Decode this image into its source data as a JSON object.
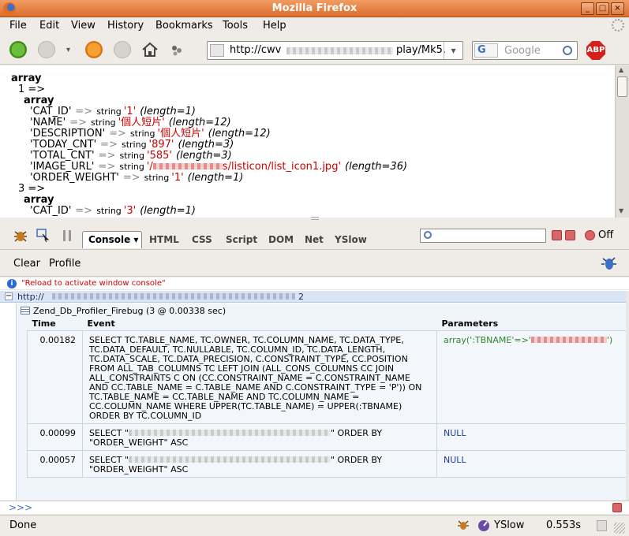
{
  "window": {
    "title": "Mozilla Firefox"
  },
  "menu": [
    "File",
    "Edit",
    "View",
    "History",
    "Bookmarks",
    "Tools",
    "Help"
  ],
  "nav": {
    "url_prefix": "http://cwv",
    "url_suffix": "play/Mk5.",
    "search_engine": "G",
    "search_placeholder": "Google",
    "adblock_label": "ABP"
  },
  "content": {
    "lines": [
      {
        "indent": 0,
        "key": "array",
        "bold": true
      },
      {
        "indent": 1,
        "key": "1 =>"
      },
      {
        "indent": 1,
        "key": "array",
        "bold": true
      },
      {
        "indent": 2,
        "key": "'CAT_ID'",
        "type": "string",
        "value": "'1'",
        "len": "(length=1)"
      },
      {
        "indent": 2,
        "key": "'NAME'",
        "type": "string",
        "value": "'個人短片'",
        "len": "(length=12)"
      },
      {
        "indent": 2,
        "key": "'DESCRIPTION'",
        "type": "string",
        "value": "'個人短片'",
        "len": "(length=12)"
      },
      {
        "indent": 2,
        "key": "'TODAY_CNT'",
        "type": "string",
        "value": "'897'",
        "len": "(length=3)"
      },
      {
        "indent": 2,
        "key": "'TOTAL_CNT'",
        "type": "string",
        "value": "'585'",
        "len": "(length=3)"
      },
      {
        "indent": 2,
        "key": "'IMAGE_URL'",
        "type": "string",
        "value": "'/",
        "value2": "s/listicon/list_icon1.jpg'",
        "len": "(length=36)"
      },
      {
        "indent": 2,
        "key": "'ORDER_WEIGHT'",
        "type": "string",
        "value": "'1'",
        "len": "(length=1)"
      },
      {
        "indent": 1,
        "key": "3 =>"
      },
      {
        "indent": 1,
        "key": "array",
        "bold": true
      },
      {
        "indent": 2,
        "key": "'CAT_ID'",
        "type": "string",
        "value": "'3'",
        "len": "(length=1)"
      }
    ],
    "arrow": "=>"
  },
  "firebug": {
    "tabs": [
      "HTML",
      "CSS",
      "Script",
      "DOM",
      "Net",
      "YSlow"
    ],
    "console_tab": "Console ▾",
    "off_label": "Off",
    "clear": "Clear",
    "profile": "Profile",
    "info_message": "\"Reload to activate window console\"",
    "group_prefix": "http://",
    "group_suffix": "2",
    "profiler_title": "Zend_Db_Profiler_Firebug (3 @ 0.00338 sec)",
    "columns": [
      "Time",
      "Event",
      "Parameters"
    ],
    "rows": [
      {
        "time": "0.00182",
        "event": "SELECT TC.TABLE_NAME, TC.OWNER, TC.COLUMN_NAME, TC.DATA_TYPE, TC.DATA_DEFAULT, TC.NULLABLE, TC.COLUMN_ID, TC.DATA_LENGTH, TC.DATA_SCALE, TC.DATA_PRECISION, C.CONSTRAINT_TYPE, CC.POSITION FROM ALL_TAB_COLUMNS TC LEFT JOIN (ALL_CONS_COLUMNS CC JOIN ALL_CONSTRAINTS C ON (CC.CONSTRAINT_NAME = C.CONSTRAINT_NAME AND CC.TABLE_NAME = C.TABLE_NAME AND C.CONSTRAINT_TYPE = 'P')) ON TC.TABLE_NAME = CC.TABLE_NAME AND TC.COLUMN_NAME = CC.COLUMN_NAME WHERE UPPER(TC.TABLE_NAME) = UPPER(:TBNAME) ORDER BY TC.COLUMN_ID",
        "param_prefix": "array(':TBNAME'=>'",
        "param_suffix": "')"
      },
      {
        "time": "0.00099",
        "event_prefix": "SELECT \"",
        "event_suffix": "\" ORDER BY \"ORDER_WEIGHT\" ASC",
        "param": "NULL"
      },
      {
        "time": "0.00057",
        "event_prefix": "SELECT \"",
        "event_suffix": "\" ORDER BY \"ORDER_WEIGHT\" ASC",
        "param": "NULL"
      }
    ],
    "command_prompt": ">>>"
  },
  "status": {
    "left": "Done",
    "yslow": "YSlow",
    "time": "0.553s"
  }
}
